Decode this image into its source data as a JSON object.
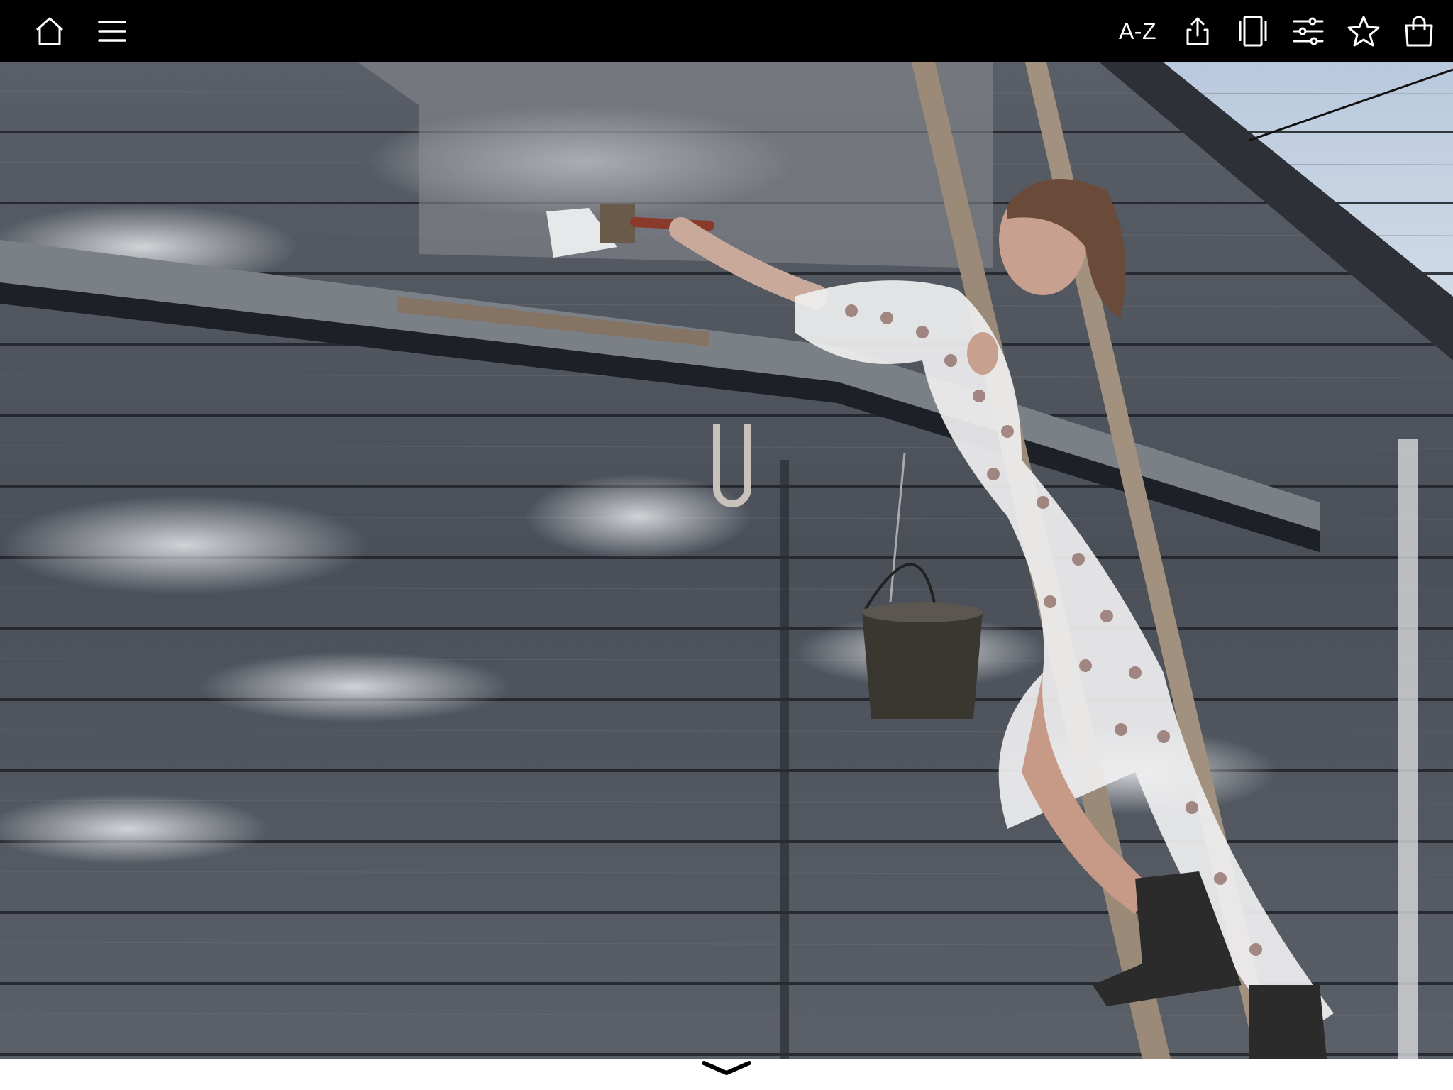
{
  "toolbar": {
    "az_label": "A-Z",
    "icons": [
      "home-icon",
      "menu-icon",
      "share-icon",
      "page-layout-icon",
      "settings-sliders-icon",
      "star-icon",
      "shopping-bag-icon"
    ]
  },
  "colors": {
    "toolbar_bg": "#000000",
    "icon": "#ffffff",
    "page_bg": "#ffffff"
  },
  "photo": {
    "description_icon": "photo-image"
  },
  "navigation": {
    "icon": "chevron-down-icon"
  }
}
